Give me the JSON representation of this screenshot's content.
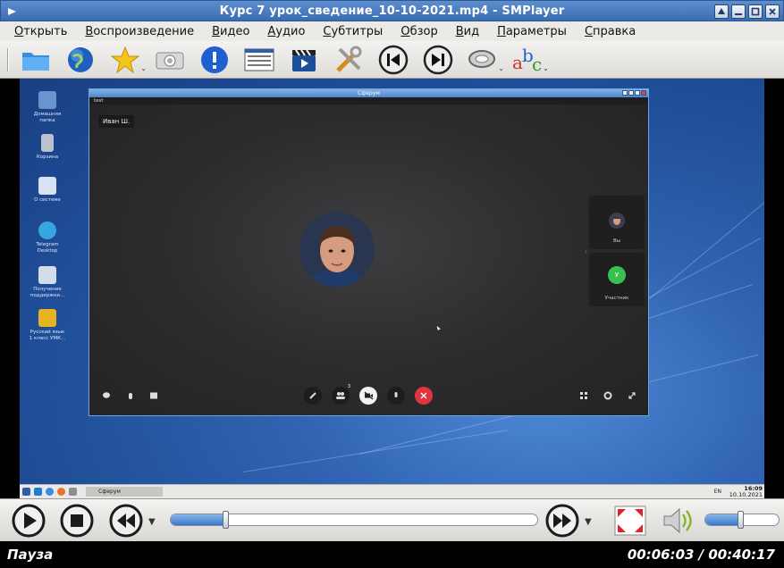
{
  "window": {
    "title": "Курс 7 урок_сведение_10-10-2021.mp4 - SMPlayer"
  },
  "menu": [
    {
      "label": "Открыть",
      "mnemonic": "О",
      "rest": "ткрыть"
    },
    {
      "label": "Воспроизведение",
      "mnemonic": "В",
      "rest": "оспроизведение"
    },
    {
      "label": "Видео",
      "mnemonic": "В",
      "rest": "идео"
    },
    {
      "label": "Аудио",
      "mnemonic": "А",
      "rest": "удио"
    },
    {
      "label": "Субтитры",
      "mnemonic": "С",
      "rest": "убтитры"
    },
    {
      "label": "Обзор",
      "mnemonic": "О",
      "rest": "бзор"
    },
    {
      "label": "Вид",
      "mnemonic": "В",
      "rest": "ид"
    },
    {
      "label": "Параметры",
      "mnemonic": "П",
      "rest": "араметры"
    },
    {
      "label": "Справка",
      "mnemonic": "С",
      "rest": "правка"
    }
  ],
  "toolbar_icons": [
    "folder-icon",
    "globe-icon",
    "favorites-star-icon",
    "screenshot-camera-icon",
    "info-icon",
    "playlist-icon",
    "video-clapper-icon",
    "preferences-tools-icon",
    "previous-track-icon",
    "next-track-icon",
    "audio-track-icon",
    "subtitles-abc-icon"
  ],
  "video": {
    "desktop_icons": [
      {
        "label": "Домашняя папка"
      },
      {
        "label": "Корзина"
      },
      {
        "label": "О системе"
      },
      {
        "label": "Telegram Desktop"
      },
      {
        "label": "Получение поддержки..."
      },
      {
        "label": "Русский язык 1 класс УМК..."
      }
    ],
    "conference": {
      "window_title": "Сферум",
      "subtitle": "test",
      "speaker_name": "Иван Ш.",
      "tiles": [
        {
          "label": "Вы"
        },
        {
          "label": "Участник",
          "initial": "У"
        }
      ],
      "participants_badge": "3"
    },
    "taskbar": {
      "task_label": "Сферум",
      "lang": "EN",
      "time": "16:09",
      "date": "10.10.2021"
    }
  },
  "controls": {
    "seek_fraction": 0.1499,
    "volume_fraction": 0.48
  },
  "status": {
    "state": "Пауза",
    "time": "00:06:03 / 00:40:17"
  },
  "colors": {
    "accent": "#3b76c4",
    "status_bg": "#000000",
    "end_call": "#e0353f"
  }
}
